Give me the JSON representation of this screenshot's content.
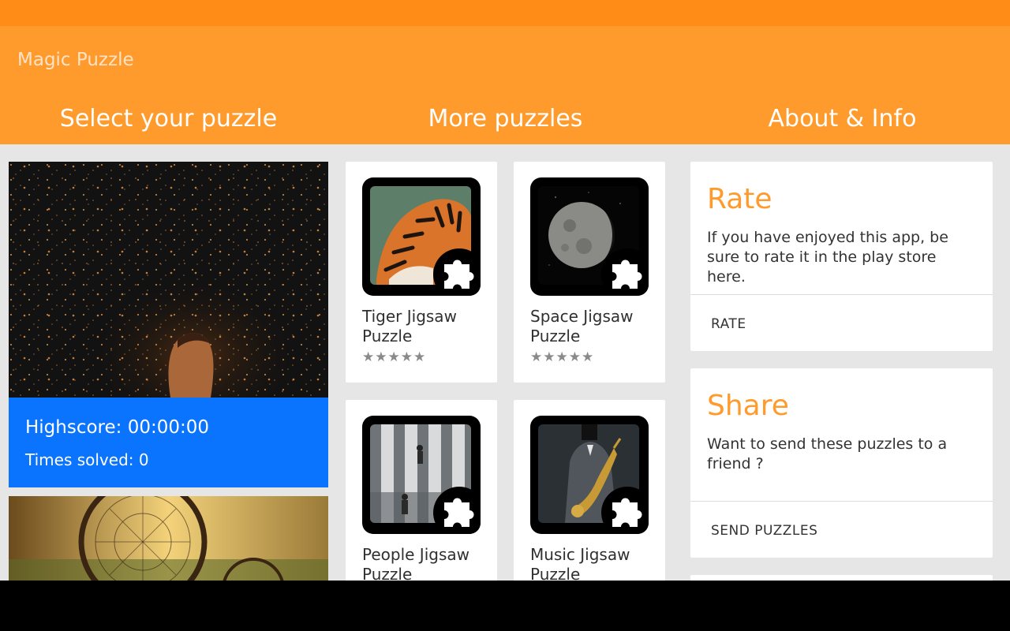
{
  "app": {
    "title": "Magic Puzzle"
  },
  "tabs": [
    {
      "label": "Select your puzzle"
    },
    {
      "label": "More puzzles"
    },
    {
      "label": "About & Info"
    }
  ],
  "puzzles": [
    {
      "highscore": "Highscore: 00:00:00",
      "times_solved": "Times solved: 0"
    }
  ],
  "more_apps": [
    {
      "name": "Tiger Jigsaw Puzzle",
      "stars": "★★★★★"
    },
    {
      "name": "Space Jigsaw Puzzle",
      "stars": "★★★★★"
    },
    {
      "name": "People Jigsaw Puzzle"
    },
    {
      "name": "Music Jigsaw Puzzle"
    }
  ],
  "about": {
    "rate": {
      "title": "Rate",
      "text": "If you have enjoyed this app, be sure to rate it in the play store here.",
      "action": "RATE"
    },
    "share": {
      "title": "Share",
      "text": "Want to send these puzzles to a friend ?",
      "action": "SEND PUZZLES"
    }
  },
  "colors": {
    "accent": "#ff9b2d",
    "status_bar": "#ff8c17",
    "score_panel": "#0a74ff",
    "background": "#e6e6e6"
  }
}
